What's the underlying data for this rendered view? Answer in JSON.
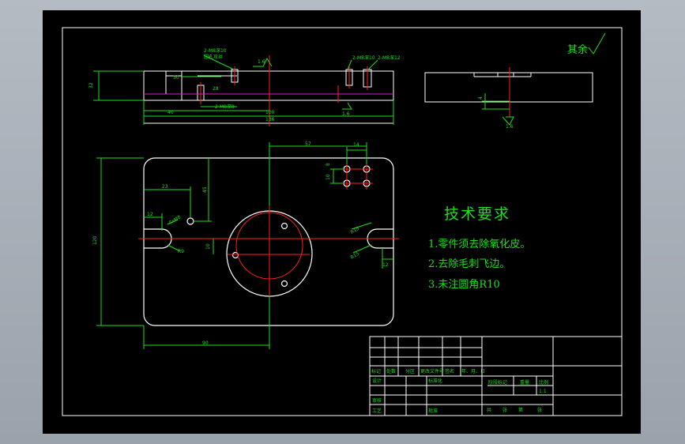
{
  "tech_requirements": {
    "title": "技术要求",
    "items": [
      "1.零件须去除氧化皮。",
      "2.去除毛刺飞边。",
      "3.未注圆角R10"
    ]
  },
  "roughness_note": "其余",
  "top_view": {
    "dims": [
      "32",
      "40",
      "100",
      "136",
      "1.6",
      "1.6",
      "30",
      "28"
    ],
    "labels": [
      "2-M8深10",
      "2-M8深10",
      "2-M8深12",
      "2-M8深8",
      "圆孔攻丝"
    ]
  },
  "side_view": {
    "dims": [
      "4",
      "1.6"
    ]
  },
  "plan_view": {
    "dims": [
      "57",
      "14",
      "23",
      "45",
      "12",
      "4xM8",
      "R9",
      "R15",
      "10",
      "120",
      "90",
      "8",
      "12",
      "15"
    ]
  },
  "title_block": {
    "row1": [
      "标记",
      "处数",
      "分区",
      "更改文件号",
      "签名",
      "年、月、日"
    ],
    "row2": [
      "设计",
      "",
      "标准化",
      "",
      "阶段标记",
      "重量",
      "比例"
    ],
    "row3": [
      "审核"
    ],
    "row4": [
      "工艺",
      "",
      "批准",
      "",
      "共",
      "张",
      "第",
      "张"
    ],
    "scale": "1:1"
  },
  "colors": {
    "background": "#000000",
    "lines": "#ffffff",
    "dims": "#19e019",
    "centerline": "#ff2020",
    "hidden": "#d020d0"
  }
}
